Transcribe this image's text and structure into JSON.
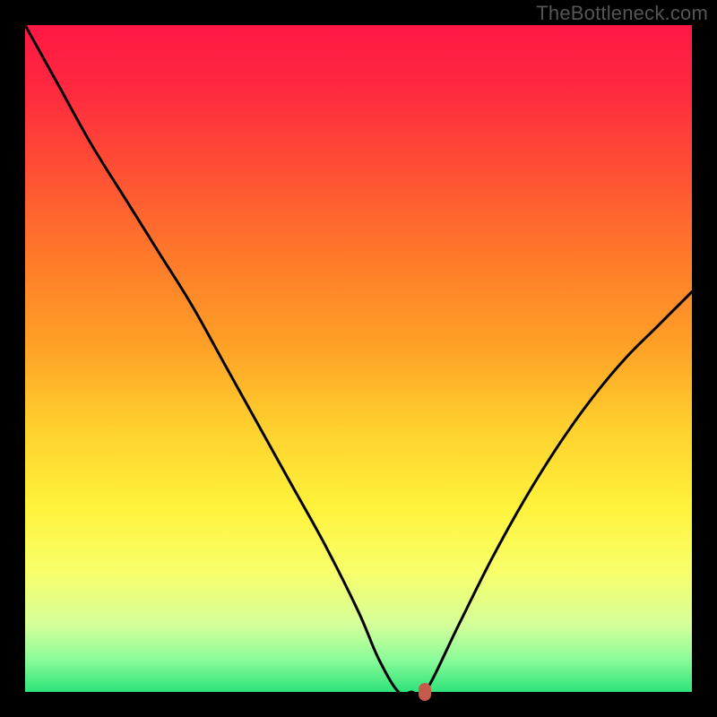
{
  "watermark": "TheBottleneck.com",
  "chart_data": {
    "type": "line",
    "x_range": [
      0,
      100
    ],
    "y_range_percent_bottleneck": [
      0,
      100
    ],
    "curve_note": "V-shaped bottleneck curve. Left arm descends from ~100% at x=0 to ~0% at x≈56; flat minimum x≈56–60; right arm rises from 0% at x≈60 to ~60% at x=100.",
    "curve_points": [
      {
        "x": 0,
        "y": 100
      },
      {
        "x": 5,
        "y": 91
      },
      {
        "x": 10,
        "y": 82
      },
      {
        "x": 15,
        "y": 74
      },
      {
        "x": 20,
        "y": 66
      },
      {
        "x": 25,
        "y": 58
      },
      {
        "x": 30,
        "y": 49
      },
      {
        "x": 35,
        "y": 40
      },
      {
        "x": 40,
        "y": 31
      },
      {
        "x": 45,
        "y": 22
      },
      {
        "x": 50,
        "y": 12
      },
      {
        "x": 53,
        "y": 5
      },
      {
        "x": 56,
        "y": 0
      },
      {
        "x": 58,
        "y": 0
      },
      {
        "x": 60,
        "y": 0
      },
      {
        "x": 65,
        "y": 10
      },
      {
        "x": 70,
        "y": 20
      },
      {
        "x": 75,
        "y": 29
      },
      {
        "x": 80,
        "y": 37
      },
      {
        "x": 85,
        "y": 44
      },
      {
        "x": 90,
        "y": 50
      },
      {
        "x": 95,
        "y": 55
      },
      {
        "x": 100,
        "y": 60
      }
    ],
    "sweet_spot_marker": {
      "x": 60,
      "y": 0,
      "color": "#c65a4b"
    },
    "background_gradient": {
      "stops": [
        {
          "offset": 0.0,
          "color": "#ff1744"
        },
        {
          "offset": 0.1,
          "color": "#ff2a3f"
        },
        {
          "offset": 0.22,
          "color": "#ff5034"
        },
        {
          "offset": 0.35,
          "color": "#ff7a2a"
        },
        {
          "offset": 0.48,
          "color": "#ffa026"
        },
        {
          "offset": 0.6,
          "color": "#ffcf2e"
        },
        {
          "offset": 0.72,
          "color": "#fff23a"
        },
        {
          "offset": 0.82,
          "color": "#f8ff6a"
        },
        {
          "offset": 0.9,
          "color": "#d4ff9a"
        },
        {
          "offset": 0.95,
          "color": "#8efc9a"
        },
        {
          "offset": 1.0,
          "color": "#2ee37a"
        }
      ]
    },
    "title": "",
    "xlabel": "",
    "ylabel": ""
  }
}
